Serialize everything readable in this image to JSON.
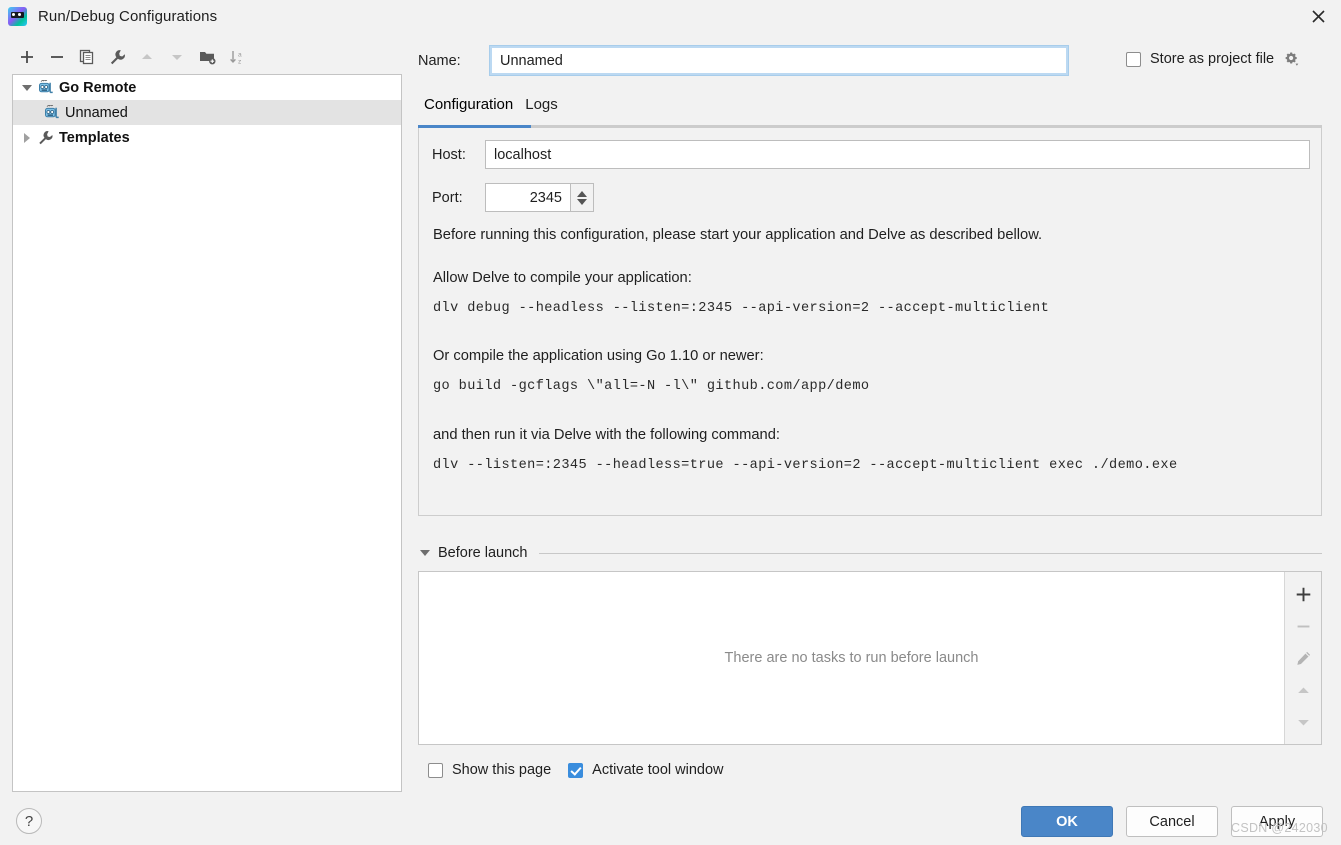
{
  "window": {
    "title": "Run/Debug Configurations",
    "app_icon": "goland-logo-icon",
    "close_icon": "close-icon"
  },
  "toolbar": {
    "buttons": [
      {
        "name": "add-configuration-button",
        "icon": "plus-icon",
        "enabled": true
      },
      {
        "name": "remove-configuration-button",
        "icon": "minus-icon",
        "enabled": true
      },
      {
        "name": "copy-configuration-button",
        "icon": "copy-icon",
        "enabled": true
      },
      {
        "name": "edit-templates-button",
        "icon": "wrench-icon",
        "enabled": true
      },
      {
        "name": "move-up-button",
        "icon": "arrow-up-icon",
        "enabled": false
      },
      {
        "name": "move-down-button",
        "icon": "arrow-down-icon",
        "enabled": false
      },
      {
        "name": "new-folder-button",
        "icon": "folder-add-icon",
        "enabled": true
      },
      {
        "name": "sort-configurations-button",
        "icon": "sort-az-icon",
        "enabled": true
      }
    ]
  },
  "tree": {
    "items": [
      {
        "label": "Go Remote",
        "icon": "go-remote-icon",
        "level": 0,
        "expanded": true,
        "bold": true,
        "selected": false
      },
      {
        "label": "Unnamed",
        "icon": "go-remote-icon",
        "level": 1,
        "expanded": null,
        "bold": false,
        "selected": true
      },
      {
        "label": "Templates",
        "icon": "wrench-icon",
        "level": 0,
        "expanded": false,
        "bold": true,
        "selected": false
      }
    ]
  },
  "name_row": {
    "label": "Name:",
    "value": "Unnamed",
    "placeholder": "Name",
    "store_as_project_file_label": "Store as project file",
    "store_as_project_file_checked": false,
    "gear_icon": "gear-dropdown-icon"
  },
  "tabs": [
    {
      "label": "Configuration",
      "active": true
    },
    {
      "label": "Logs",
      "active": false
    }
  ],
  "configuration": {
    "host": {
      "label": "Host:",
      "value": "localhost",
      "placeholder": "localhost"
    },
    "port": {
      "label": "Port:",
      "value": "2345",
      "placeholder": "2345"
    },
    "intro": "Before running this configuration, please start your application and Delve as described bellow.",
    "sections": [
      {
        "heading": "Allow Delve to compile your application:",
        "code": "dlv debug --headless --listen=:2345 --api-version=2 --accept-multiclient"
      },
      {
        "heading": "Or compile the application using Go 1.10 or newer:",
        "code": "go build -gcflags \\\"all=-N -l\\\" github.com/app/demo"
      },
      {
        "heading": "and then run it via Delve with the following command:",
        "code": "dlv --listen=:2345 --headless=true --api-version=2 --accept-multiclient exec ./demo.exe"
      }
    ]
  },
  "before_launch": {
    "title": "Before launch",
    "expanded": true,
    "empty_message": "There are no tasks to run before launch",
    "side_buttons": [
      {
        "name": "add-task-button",
        "icon": "plus-icon",
        "enabled": true
      },
      {
        "name": "remove-task-button",
        "icon": "minus-icon",
        "enabled": false
      },
      {
        "name": "edit-task-button",
        "icon": "pencil-icon",
        "enabled": false
      },
      {
        "name": "move-task-up-button",
        "icon": "arrow-up-icon",
        "enabled": false
      },
      {
        "name": "move-task-down-button",
        "icon": "arrow-down-icon",
        "enabled": false
      }
    ]
  },
  "footer": {
    "show_this_page_label": "Show this page",
    "show_this_page_checked": false,
    "activate_tool_window_label": "Activate tool window",
    "activate_tool_window_checked": true,
    "help_label": "?",
    "ok_label": "OK",
    "cancel_label": "Cancel",
    "apply_label": "Apply"
  },
  "watermark": "CSDN @242030",
  "colors": {
    "accent": "#4a86c8",
    "background": "#f2f2f2",
    "selection": "#e3e3e3",
    "field_border": "#bdbdbd",
    "focus_ring": "#a8cdeb"
  }
}
